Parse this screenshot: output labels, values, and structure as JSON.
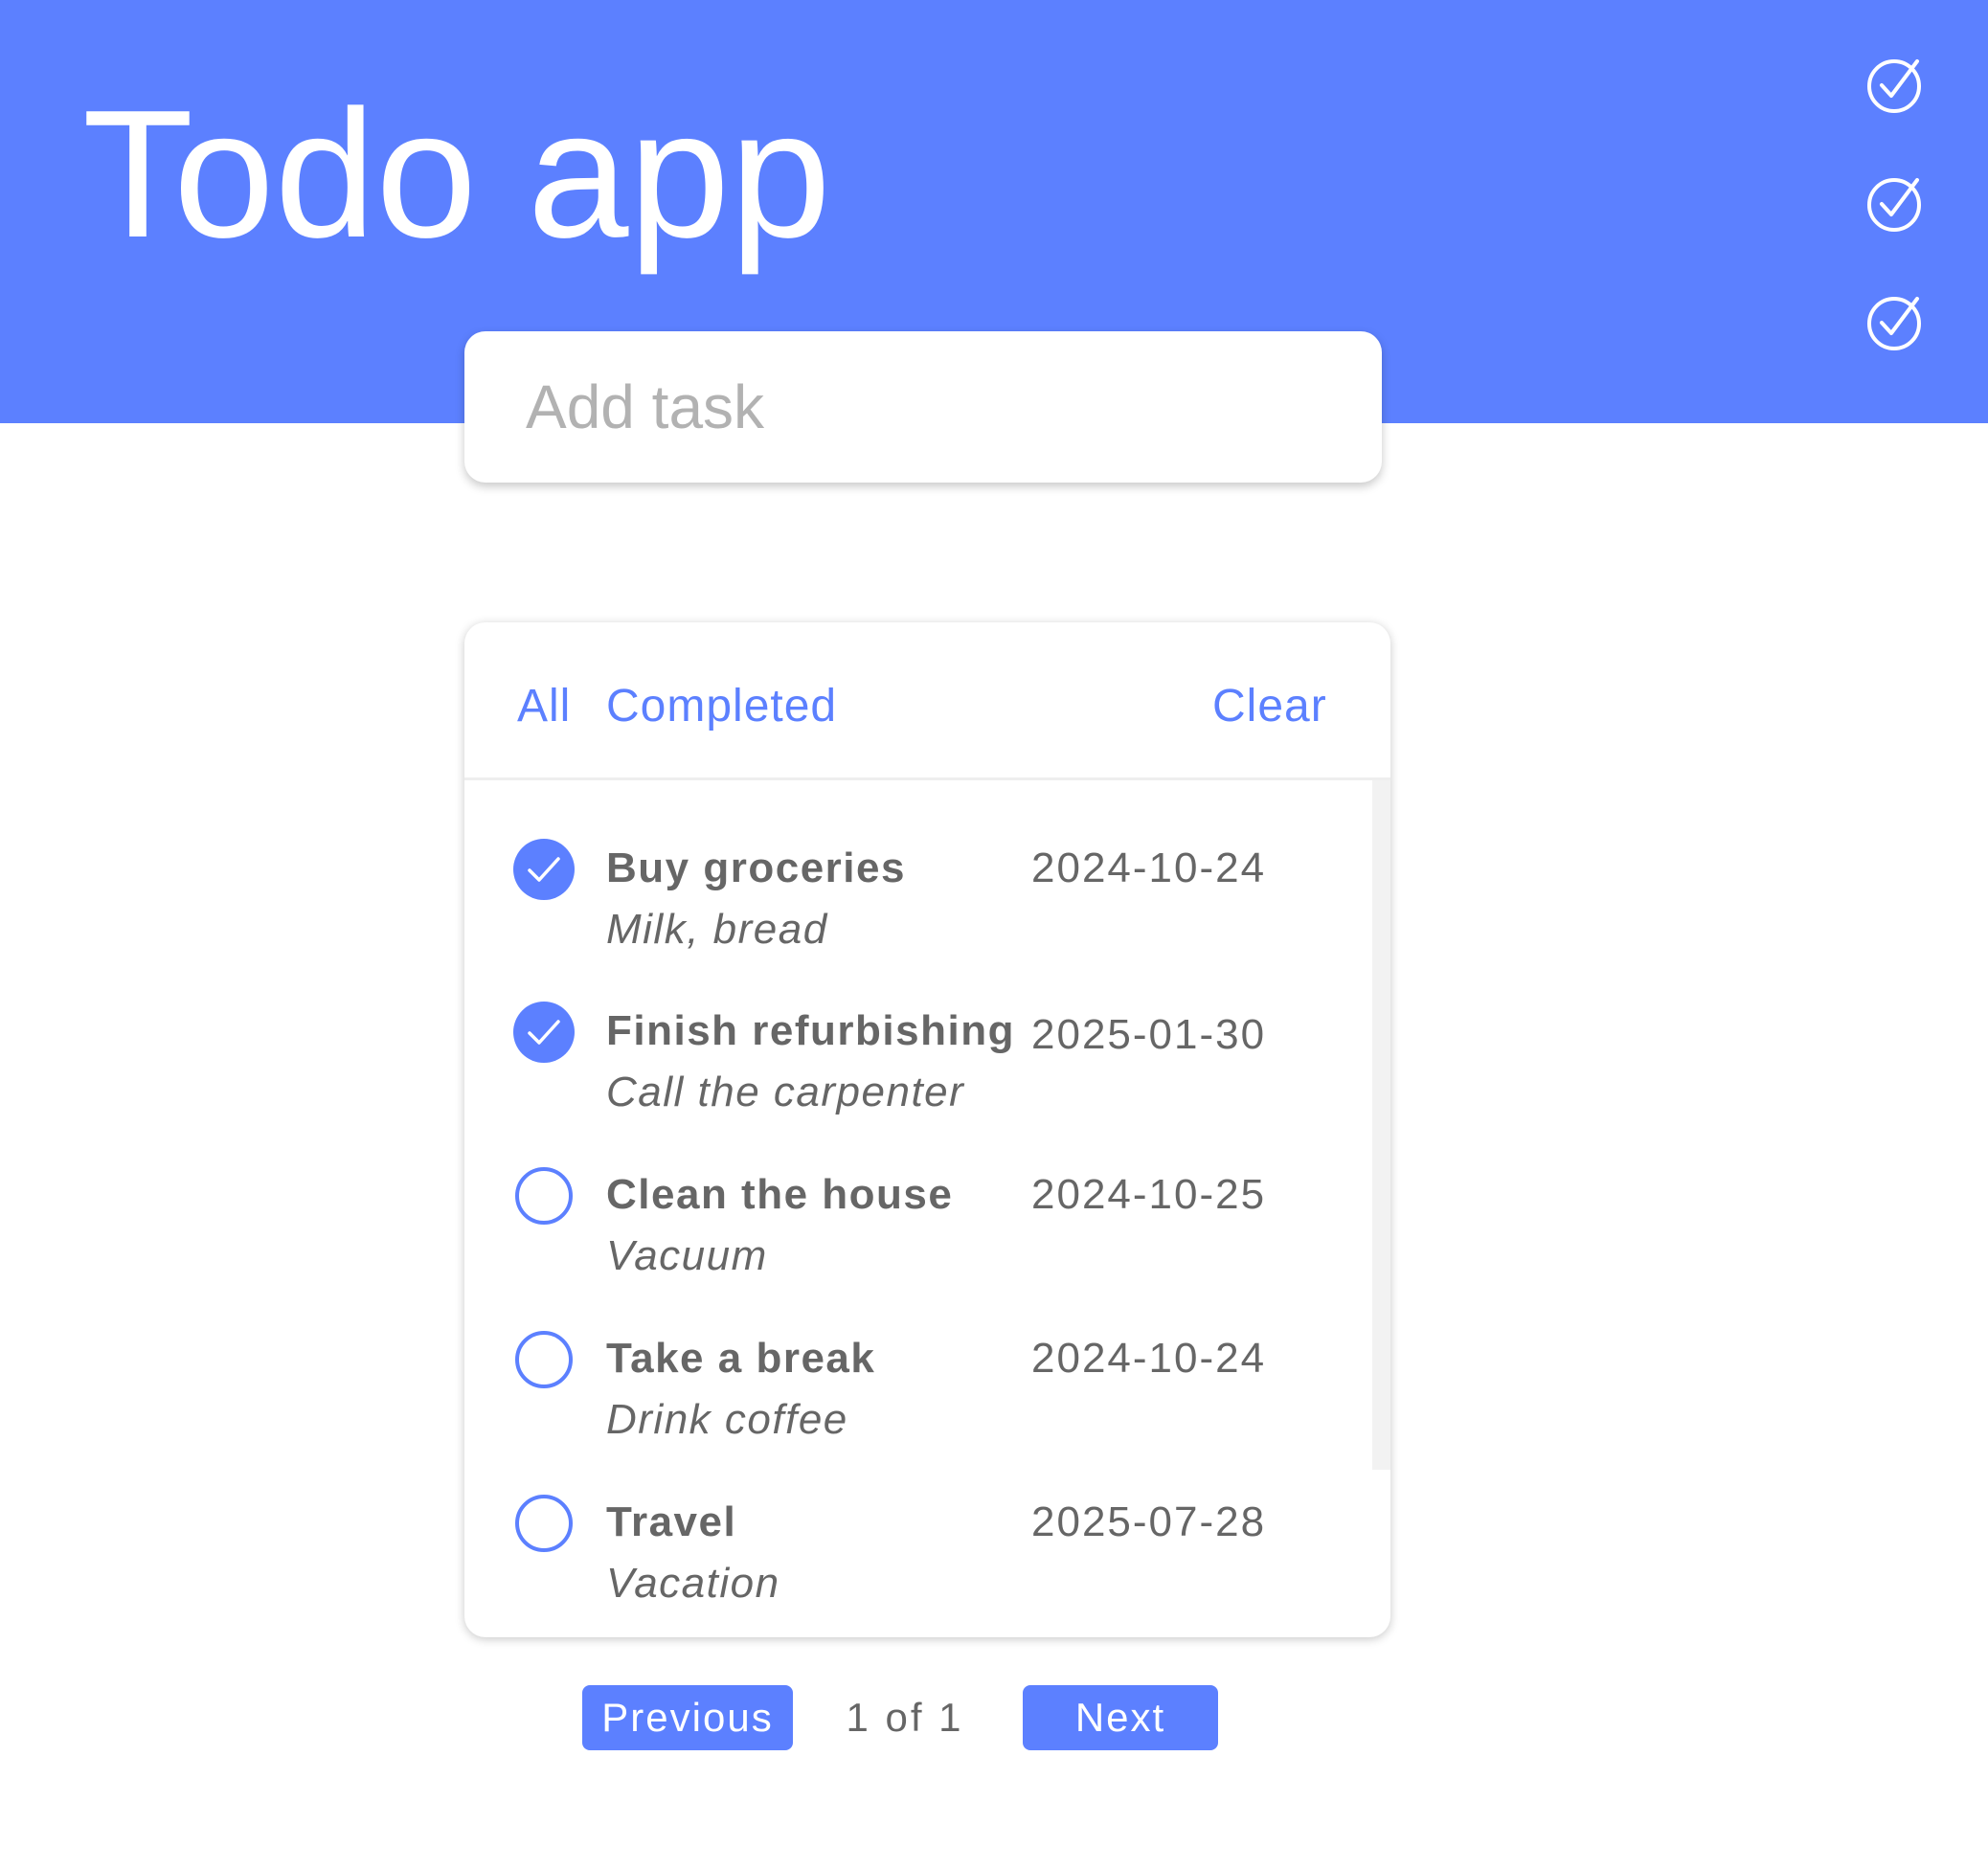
{
  "app": {
    "title": "Todo app",
    "accent_color": "#5c80ff"
  },
  "header": {
    "decor_icons": [
      "check-circle-icon",
      "check-circle-icon",
      "check-circle-icon"
    ]
  },
  "add_task": {
    "placeholder": "Add task",
    "value": ""
  },
  "filters": {
    "all_label": "All",
    "completed_label": "Completed",
    "clear_label": "Clear"
  },
  "tasks": [
    {
      "title": "Buy groceries",
      "note": "Milk, bread",
      "date": "2024-10-24",
      "completed": true
    },
    {
      "title": "Finish refurbishing",
      "note": "Call the carpenter",
      "date": "2025-01-30",
      "completed": true
    },
    {
      "title": "Clean the house",
      "note": "Vacuum",
      "date": "2024-10-25",
      "completed": false
    },
    {
      "title": "Take a break",
      "note": "Drink coffee",
      "date": "2024-10-24",
      "completed": false
    },
    {
      "title": "Travel",
      "note": "Vacation",
      "date": "2025-07-28",
      "completed": false
    }
  ],
  "pagination": {
    "previous_label": "Previous",
    "page_text": "1 of 1",
    "next_label": "Next"
  }
}
